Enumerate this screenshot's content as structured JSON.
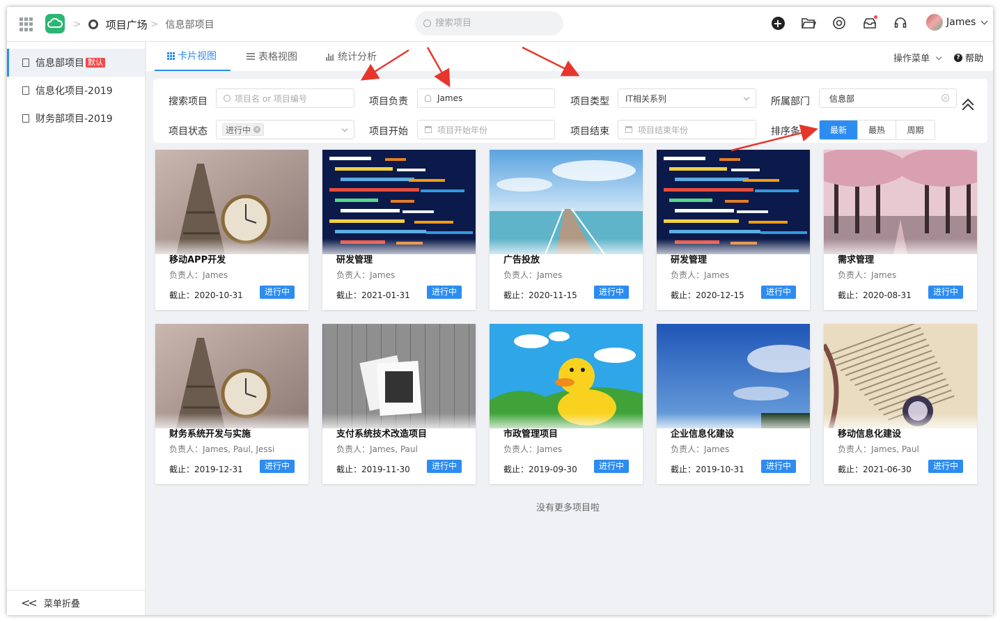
{
  "header": {
    "breadcrumb_root": "项目广场",
    "breadcrumb_current": "信息部项目",
    "search_placeholder": "搜索项目",
    "user_name": "James"
  },
  "sidebar": {
    "items": [
      {
        "label": "信息部项目",
        "badge": "默认",
        "active": true
      },
      {
        "label": "信息化项目-2019"
      },
      {
        "label": "财务部项目-2019"
      }
    ],
    "collapse_label": "菜单折叠"
  },
  "view_tabs": [
    {
      "label": "卡片视图",
      "active": true
    },
    {
      "label": "表格视图"
    },
    {
      "label": "统计分析"
    }
  ],
  "toolbar": {
    "ops_menu": "操作菜单",
    "help": "帮助"
  },
  "filters": {
    "search_label": "搜索项目",
    "search_placeholder": "项目名 or 项目编号",
    "owner_label": "项目负责",
    "owner_value": "James",
    "type_label": "项目类型",
    "type_value": "IT相关系列",
    "dept_label": "所属部门",
    "dept_value": "信息部",
    "status_label": "项目状态",
    "status_value": "进行中",
    "start_label": "项目开始",
    "start_placeholder": "项目开始年份",
    "end_label": "项目结束",
    "end_placeholder": "项目结束年份",
    "sort_label": "排序条件",
    "sort_options": [
      "最新",
      "最热",
      "周期"
    ],
    "sort_selected": "最新"
  },
  "cards": [
    {
      "title": "移动APP开发",
      "owner": "负责人：James",
      "due": "截止：2020-10-31",
      "status": "进行中",
      "image": "eiffel-clock"
    },
    {
      "title": "研发管理",
      "owner": "负责人：James",
      "due": "截止：2021-01-31",
      "status": "进行中",
      "image": "code"
    },
    {
      "title": "广告投放",
      "owner": "负责人：James",
      "due": "截止：2020-11-15",
      "status": "进行中",
      "image": "pier"
    },
    {
      "title": "研发管理",
      "owner": "负责人：James",
      "due": "截止：2020-12-15",
      "status": "进行中",
      "image": "code"
    },
    {
      "title": "需求管理",
      "owner": "负责人：James",
      "due": "截止：2020-08-31",
      "status": "进行中",
      "image": "blossom-trees"
    },
    {
      "title": "财务系统开发与实施",
      "owner": "负责人：James, Paul, Jessi",
      "due": "截止：2019-12-31",
      "status": "进行中",
      "image": "eiffel-clock"
    },
    {
      "title": "支付系统技术改造项目",
      "owner": "负责人：James, Paul",
      "due": "截止：2019-11-30",
      "status": "进行中",
      "image": "photos-wood"
    },
    {
      "title": "市政管理项目",
      "owner": "负责人：James",
      "due": "截止：2019-09-30",
      "status": "进行中",
      "image": "duck"
    },
    {
      "title": "企业信息化建设",
      "owner": "负责人：James",
      "due": "截止：2019-10-31",
      "status": "进行中",
      "image": "sky"
    },
    {
      "title": "移动信息化建设",
      "owner": "负责人：James, Paul",
      "due": "截止：2021-06-30",
      "status": "进行中",
      "image": "book"
    }
  ],
  "footer_note": "没有更多项目啦"
}
